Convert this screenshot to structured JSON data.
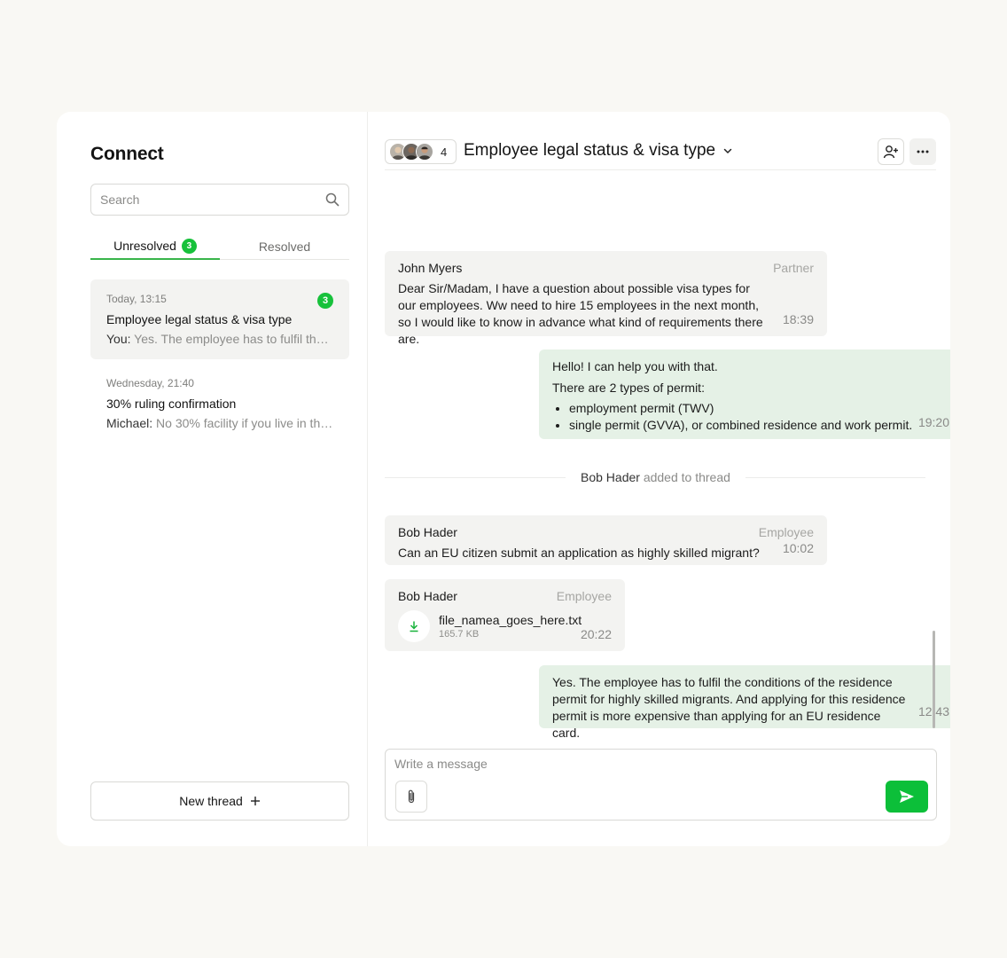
{
  "app": {
    "title": "Connect"
  },
  "search": {
    "placeholder": "Search",
    "value": ""
  },
  "tabs": [
    {
      "label": "Unresolved",
      "badge": "3",
      "active": true
    },
    {
      "label": "Resolved",
      "active": false
    }
  ],
  "threads": [
    {
      "time": "Today, 13:15",
      "title": "Employee legal status & visa type",
      "sender": "You:",
      "preview": "Yes. The employee has to fulfil the conditions of the residence permit...",
      "badge": "3",
      "selected": true
    },
    {
      "time": "Wednesday, 21:40",
      "title": "30% ruling confirmation",
      "sender": "Michael:",
      "preview": "No 30% facility if you live in the border zone...",
      "selected": false
    }
  ],
  "new_thread": {
    "label": "New thread",
    "icon": "plus-icon"
  },
  "header": {
    "participant_count": "4",
    "title": "Employee legal status & visa type",
    "add_person_icon": "add-person-icon",
    "more_icon": "more-icon"
  },
  "messages": [
    {
      "sender": "John Myers",
      "role": "Partner",
      "text": "Dear Sir/Madam, I have a question about possible visa types for our employees. Ww need to hire 15 employees in the next month, so I would like to know in advance what kind of requirements there are.",
      "time": "18:39"
    },
    {
      "line1": "Hello! I can help you with that.",
      "line2": "There are 2 types of permit:",
      "bullets": [
        "employment permit (TWV)",
        "single permit (GVVA), or combined residence and work permit."
      ],
      "time": "19:20"
    },
    {
      "sender": "Bob Hader",
      "role": "Employee",
      "text": "Can an EU citizen submit an application as highly skilled migrant?",
      "time": "10:02"
    },
    {
      "sender": "Bob Hader",
      "role": "Employee",
      "file_name": "file_namea_goes_here.txt",
      "file_size": "165.7 KB",
      "time": "20:22"
    },
    {
      "text": "Yes. The employee has to fulfil the conditions of the residence permit for highly skilled migrants. And applying for this residence permit is more expensive than applying for an EU residence card.",
      "time": "12:43"
    }
  ],
  "system_event": {
    "name": "Bob Hader",
    "action": "added to thread"
  },
  "composer": {
    "placeholder": "Write a message",
    "value": ""
  },
  "colors": {
    "accent": "#17c13b",
    "outgoing_bubble": "#e5f1e6",
    "incoming_bubble": "#f3f3f1"
  }
}
